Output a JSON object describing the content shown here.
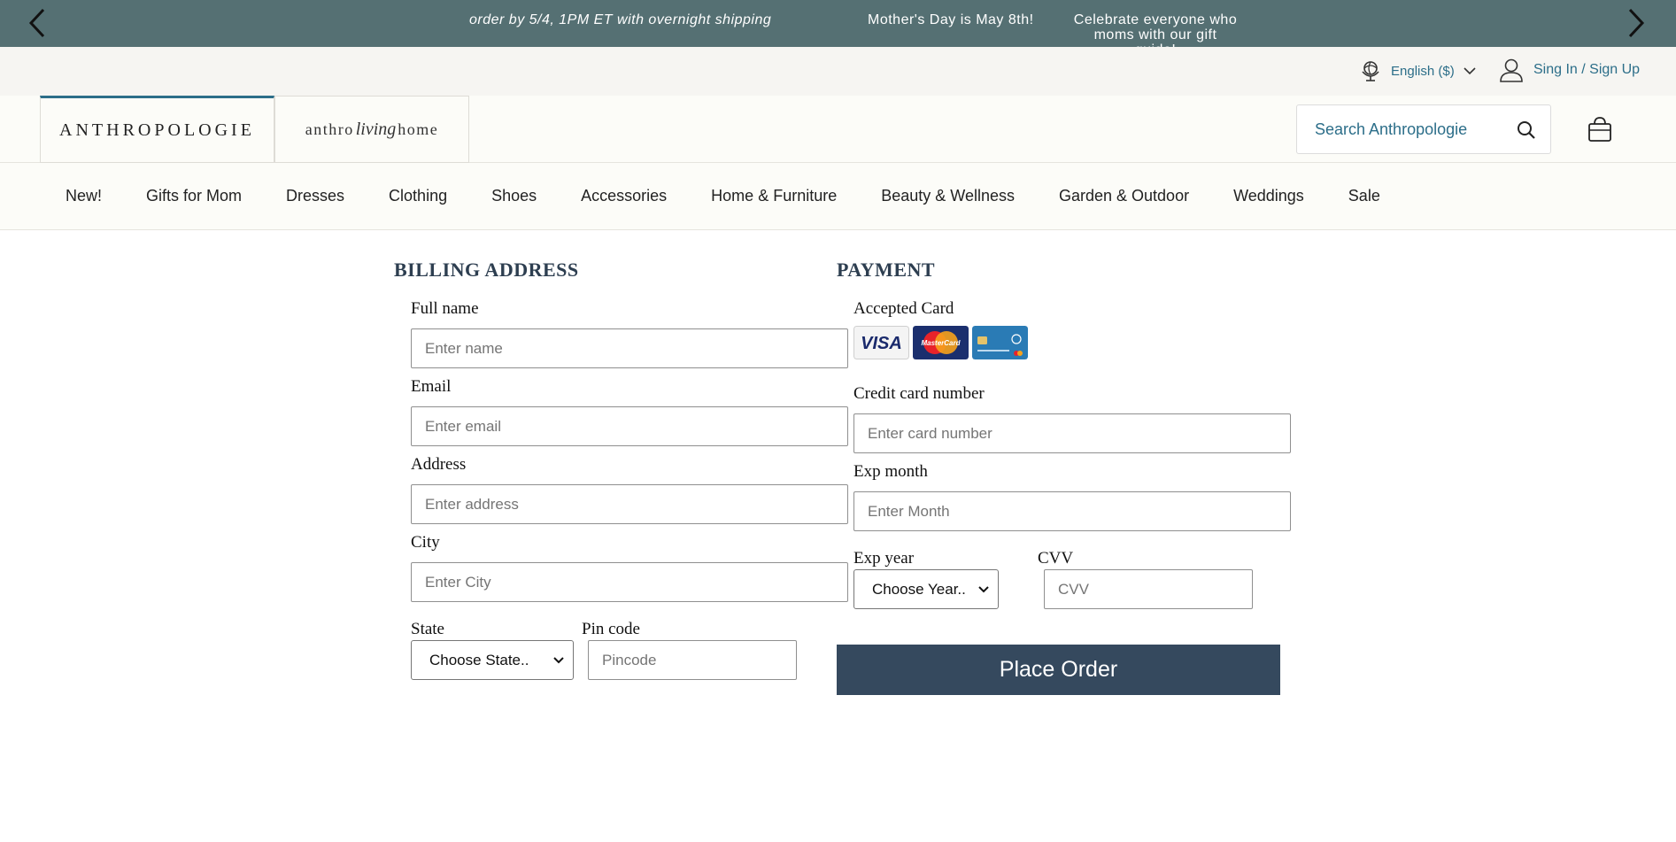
{
  "promo": {
    "message_1": "order by 5/4, 1PM ET with overnight shipping",
    "message_2": "Mother's Day is May 8th!",
    "message_3": "Celebrate everyone who moms with our gift guide!"
  },
  "util": {
    "language": "English ($)",
    "sign_in": "Sing In / Sign Up"
  },
  "header": {
    "brand": "ANTHROPOLOGIE",
    "brand2_pre": "anthro",
    "brand2_script": "living",
    "brand2_post": "home",
    "search_placeholder": "Search Anthropologie"
  },
  "nav": {
    "items": [
      "New!",
      "Gifts for Mom",
      "Dresses",
      "Clothing",
      "Shoes",
      "Accessories",
      "Home & Furniture",
      "Beauty & Wellness",
      "Garden & Outdoor",
      "Weddings",
      "Sale"
    ]
  },
  "billing": {
    "title": "BILLING ADDRESS",
    "full_name_label": "Full name",
    "full_name_placeholder": "Enter name",
    "email_label": "Email",
    "email_placeholder": "Enter email",
    "address_label": "Address",
    "address_placeholder": "Enter address",
    "city_label": "City",
    "city_placeholder": "Enter City",
    "state_label": "State",
    "state_value": "Choose State..",
    "pin_label": "Pin code",
    "pin_placeholder": "Pincode"
  },
  "payment": {
    "title": "PAYMENT",
    "accepted_label": "Accepted Card",
    "cards": [
      "VISA",
      "MasterCard",
      "generic-card"
    ],
    "card_number_label": "Credit card number",
    "card_number_placeholder": "Enter card number",
    "exp_month_label": "Exp month",
    "exp_month_placeholder": "Enter Month",
    "exp_year_label": "Exp year",
    "exp_year_value": "Choose Year..",
    "cvv_label": "CVV",
    "cvv_placeholder": "CVV",
    "place_order": "Place Order"
  },
  "colors": {
    "promo_bg": "#557073",
    "link": "#2c6e89",
    "title": "#2d3e50",
    "button_bg": "#35495e"
  }
}
